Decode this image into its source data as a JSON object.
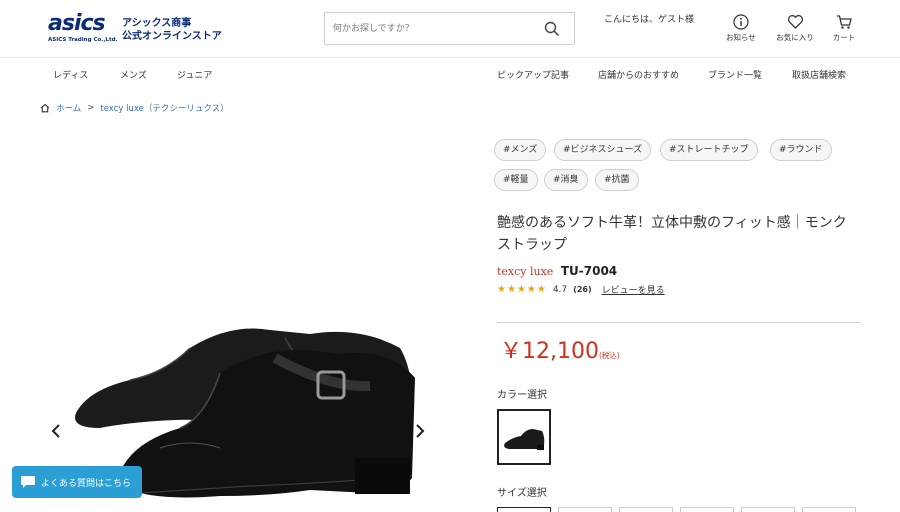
{
  "header": {
    "logo_text": "asics",
    "logo_subtext": "ASICS Trading Co.,Ltd.",
    "brand_line1": "アシックス商事",
    "brand_line2": "公式オンラインストア",
    "search_placeholder": "何かお探しですか？",
    "greeting": "こんにちは、ゲスト様",
    "icons": [
      {
        "name": "info-icon",
        "label": "お知らせ"
      },
      {
        "name": "heart-icon",
        "label": "お気に入り"
      },
      {
        "name": "cart-icon",
        "label": "カート"
      }
    ]
  },
  "nav": {
    "left": [
      "レディス",
      "メンズ",
      "ジュニア"
    ],
    "right": [
      "ピックアップ記事",
      "店舗からのおすすめ",
      "ブランド一覧",
      "取扱店舗検索"
    ]
  },
  "breadcrumb": {
    "home": "ホーム",
    "separator": ">",
    "current": "texcy luxe（テクシーリュクス）"
  },
  "product": {
    "tags": [
      "#メンズ",
      "#ビジネスシューズ",
      "#ストレートチップ",
      "#ラウンド",
      "#軽量",
      "#消臭",
      "#抗菌"
    ],
    "title": "艶感のあるソフト牛革！立体中敷のフィット感｜モンクストラップ",
    "brand": "texcy luxe",
    "model": "TU-7004",
    "rating_stars": "★★★★★",
    "rating_score": "4.7",
    "review_count": "(26)",
    "review_link": "レビューを見る",
    "price": "￥12,100",
    "tax_note": "(税込)",
    "color_label": "カラー選択",
    "size_label": "サイズ選択"
  },
  "faq": {
    "label": "よくある質問はこちら"
  },
  "colors": {
    "brand_navy": "#0b2a78",
    "price_red": "#d0311c",
    "faq_blue": "#2b9ed6",
    "link_blue": "#3d6fb5"
  }
}
